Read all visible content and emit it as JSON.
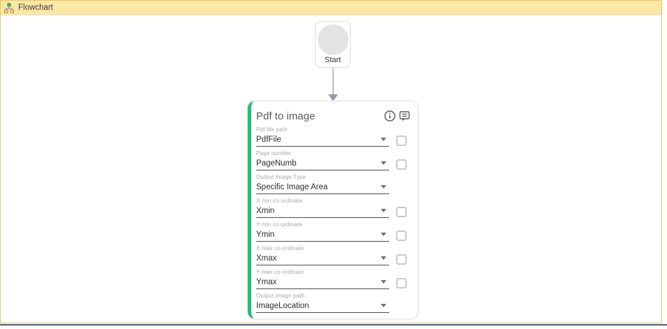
{
  "header": {
    "title": "Flowchart"
  },
  "canvas": {
    "start_node": {
      "label": "Start"
    },
    "activity_card": {
      "title": "Pdf to image",
      "accent_color": "#21BE77",
      "icons": [
        "info-icon",
        "annotation-icon"
      ],
      "fields": [
        {
          "label": "Pdf file path",
          "value": "PdfFile",
          "dropdown": true,
          "checkbox": true
        },
        {
          "label": "Page number",
          "value": "PageNumb",
          "dropdown": true,
          "checkbox": true
        },
        {
          "label": "Output Image Type",
          "value": "Specific Image Area",
          "dropdown": true,
          "checkbox": false
        },
        {
          "label": "X min co-ordinate",
          "value": "Xmin",
          "dropdown": true,
          "checkbox": true
        },
        {
          "label": "Y min co-ordinate",
          "value": "Ymin",
          "dropdown": true,
          "checkbox": true
        },
        {
          "label": "X max co-ordinate",
          "value": "Xmax",
          "dropdown": true,
          "checkbox": true
        },
        {
          "label": "Y max co-ordinate",
          "value": "Ymax",
          "dropdown": true,
          "checkbox": true
        },
        {
          "label": "Output image path",
          "value": "ImageLocation",
          "dropdown": true,
          "checkbox": false
        }
      ]
    }
  },
  "colors": {
    "container_border": "#E5C469",
    "header_background": "#FBE7A4",
    "bottom_divider": "#4A5D80",
    "activity_accent": "#21BE77"
  }
}
